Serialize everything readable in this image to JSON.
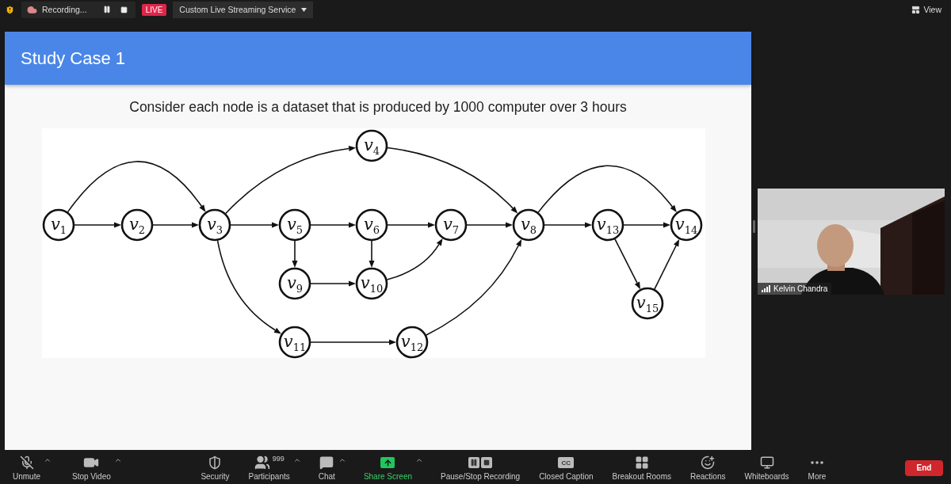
{
  "top_bar": {
    "recording": "Recording...",
    "live_badge": "LIVE",
    "streaming_service": "Custom Live Streaming Service",
    "view_button": "View"
  },
  "slide": {
    "title": "Study Case 1",
    "subtitle": "Consider each node is a dataset that is produced by 1000 computer over 3 hours",
    "graph": {
      "nodes": [
        {
          "letter": "v",
          "index": "1"
        },
        {
          "letter": "v",
          "index": "2"
        },
        {
          "letter": "v",
          "index": "3"
        },
        {
          "letter": "v",
          "index": "4"
        },
        {
          "letter": "v",
          "index": "5"
        },
        {
          "letter": "v",
          "index": "6"
        },
        {
          "letter": "v",
          "index": "7"
        },
        {
          "letter": "v",
          "index": "8"
        },
        {
          "letter": "v",
          "index": "9"
        },
        {
          "letter": "v",
          "index": "10"
        },
        {
          "letter": "v",
          "index": "11"
        },
        {
          "letter": "v",
          "index": "12"
        },
        {
          "letter": "v",
          "index": "13"
        },
        {
          "letter": "v",
          "index": "14"
        },
        {
          "letter": "v",
          "index": "15"
        }
      ]
    }
  },
  "video_tile": {
    "name": "Kelvin Chandra"
  },
  "toolbar": {
    "items": [
      {
        "kind": "mic",
        "label": "Unmute",
        "caret": true
      },
      {
        "kind": "video",
        "label": "Stop Video",
        "caret": true
      },
      {
        "kind": "security",
        "label": "Security",
        "caret": false
      },
      {
        "kind": "participants",
        "label": "Participants",
        "count": "999",
        "caret": true
      },
      {
        "kind": "chat",
        "label": "Chat",
        "caret": true
      },
      {
        "kind": "share",
        "label": "Share Screen",
        "caret": true
      },
      {
        "kind": "recording",
        "label": "Pause/Stop Recording",
        "caret": false
      },
      {
        "kind": "captions",
        "label": "Closed Caption",
        "icon_text": "CC",
        "caret": false
      },
      {
        "kind": "breakout",
        "label": "Breakout Rooms",
        "caret": false
      },
      {
        "kind": "reactions",
        "label": "Reactions",
        "caret": false
      },
      {
        "kind": "whiteboards",
        "label": "Whiteboards",
        "caret": false
      },
      {
        "kind": "more",
        "label": "More",
        "caret": false
      }
    ],
    "end_button": "End"
  }
}
